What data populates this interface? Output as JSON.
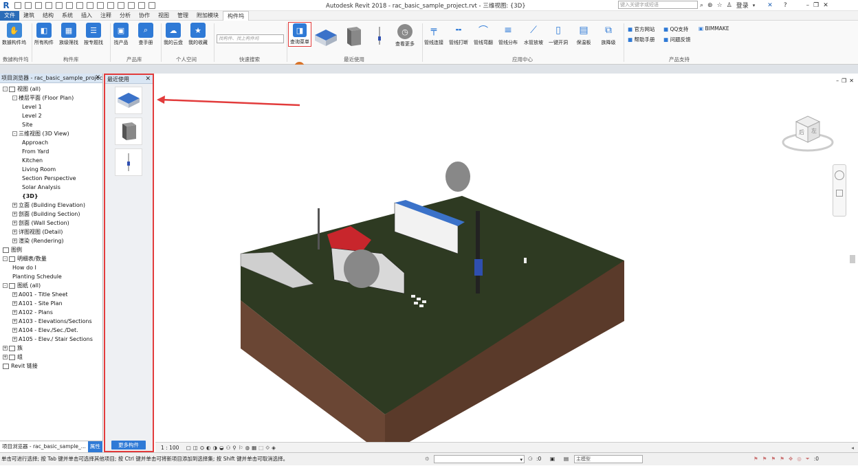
{
  "app": {
    "title": "Autodesk Revit 2018 -    rac_basic_sample_project.rvt - 三维视图: {3D}",
    "search_placeholder": "键入关键字或短语",
    "login": "登录",
    "logo": "R"
  },
  "tabs": [
    "文件",
    "建筑",
    "结构",
    "系统",
    "插入",
    "注释",
    "分析",
    "协作",
    "视图",
    "管理",
    "附加模块",
    "构件坞"
  ],
  "active_tab": "构件坞",
  "ribbon": {
    "buttons": {
      "sync": "数據构件坞",
      "all_parts": "所有构件",
      "by_category": "族级筛找",
      "by_library": "按专题找",
      "find_product": "找产品",
      "manual": "查手册",
      "my_cloud": "我的云盘",
      "my_favorites": "我的收藏",
      "quick_search_placeholder": "找构件、找上构件坞",
      "all_menu": "查询菜单",
      "see_more": "查看更多",
      "pipe_connect": "管线连接",
      "pipe_break": "管线打断",
      "pipe_bend": "管线弯翻",
      "pipe_distribute": "管线分布",
      "water_pipe": "水管放坡",
      "one_click_open": "一键开洞",
      "plate": "保温板",
      "floor_drop": "族降级",
      "official_site": "官方网站",
      "qq_support": "QQ支持",
      "bimmake": "BIMMAKE",
      "help_manual": "帮助手册",
      "feedback": "问题反馈"
    },
    "panels": {
      "sync": "数據构件坞",
      "library": "构件库",
      "product": "产品库",
      "personal": "个人空间",
      "quick_search": "快速搜索",
      "recent": "最近使用",
      "app_center": "应用中心",
      "product_support": "产品支持"
    },
    "badge": "1"
  },
  "project_browser": {
    "title": "项目浏览器 - rac_basic_sample_projec...",
    "nodes": [
      {
        "label": "视图 (all)",
        "level": 0,
        "exp": "-"
      },
      {
        "label": "楼层平面 (Floor Plan)",
        "level": 1,
        "exp": "-"
      },
      {
        "label": "Level 1",
        "level": 2,
        "exp": ""
      },
      {
        "label": "Level 2",
        "level": 2,
        "exp": ""
      },
      {
        "label": "Site",
        "level": 2,
        "exp": ""
      },
      {
        "label": "三维视图 (3D View)",
        "level": 1,
        "exp": "-"
      },
      {
        "label": "Approach",
        "level": 2,
        "exp": ""
      },
      {
        "label": "From Yard",
        "level": 2,
        "exp": ""
      },
      {
        "label": "Kitchen",
        "level": 2,
        "exp": ""
      },
      {
        "label": "Living Room",
        "level": 2,
        "exp": ""
      },
      {
        "label": "Section Perspective",
        "level": 2,
        "exp": ""
      },
      {
        "label": "Solar Analysis",
        "level": 2,
        "exp": ""
      },
      {
        "label": "{3D}",
        "level": 2,
        "exp": "",
        "bold": true
      },
      {
        "label": "立面 (Building Elevation)",
        "level": 1,
        "exp": "+"
      },
      {
        "label": "剖面 (Building Section)",
        "level": 1,
        "exp": "+"
      },
      {
        "label": "剖面 (Wall Section)",
        "level": 1,
        "exp": "+"
      },
      {
        "label": "详图视图 (Detail)",
        "level": 1,
        "exp": "+"
      },
      {
        "label": "渲染 (Rendering)",
        "level": 1,
        "exp": "+"
      },
      {
        "label": "图例",
        "level": 0,
        "exp": ""
      },
      {
        "label": "明细表/数量",
        "level": 0,
        "exp": "-"
      },
      {
        "label": "How do I",
        "level": 1,
        "exp": ""
      },
      {
        "label": "Planting Schedule",
        "level": 1,
        "exp": ""
      },
      {
        "label": "图纸 (all)",
        "level": 0,
        "exp": "-"
      },
      {
        "label": "A001 - Title Sheet",
        "level": 1,
        "exp": "+"
      },
      {
        "label": "A101 - Site Plan",
        "level": 1,
        "exp": "+"
      },
      {
        "label": "A102 - Plans",
        "level": 1,
        "exp": "+"
      },
      {
        "label": "A103 - Elevations/Sections",
        "level": 1,
        "exp": "+"
      },
      {
        "label": "A104 - Elev./Sec./Det.",
        "level": 1,
        "exp": "+"
      },
      {
        "label": "A105 - Elev./ Stair Sections",
        "level": 1,
        "exp": "+"
      },
      {
        "label": "族",
        "level": 0,
        "exp": "+"
      },
      {
        "label": "组",
        "level": 0,
        "exp": "+"
      },
      {
        "label": "Revit 链接",
        "level": 0,
        "exp": ""
      }
    ],
    "footer_tab1": "项目浏览器 - rac_basic_sample_...",
    "footer_tab2": "属性"
  },
  "recent_panel": {
    "title": "最近使用",
    "more_button": "更多构件"
  },
  "view": {
    "scale": "1 : 100",
    "viewcube_left": "左",
    "viewcube_front": "后"
  },
  "status": {
    "message": "单击可进行选择; 按 Tab 键并单击可选择其他项目; 按 Ctrl 键并单击可将新项目添加到选择集; 按 Shift 键并单击可取消选择。",
    "coord_value": ":0",
    "model": "主模型",
    "filter": ":0"
  },
  "colors": {
    "accent": "#2f7ad6",
    "highlight": "#e23b3b",
    "terrain_top": "#2e3a22",
    "terrain_side": "#5a3a2a"
  }
}
